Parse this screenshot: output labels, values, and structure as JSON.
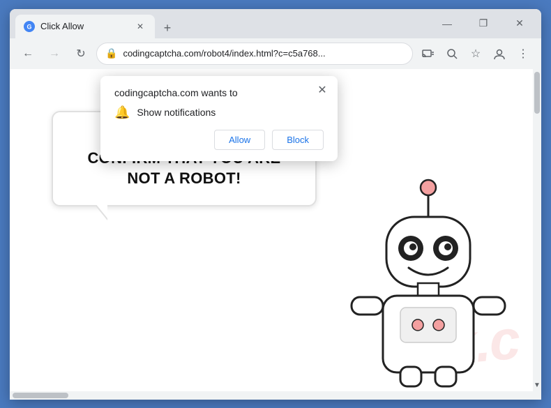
{
  "browser": {
    "tab_title": "Click Allow",
    "tab_favicon": "G",
    "address": "codingcaptcha.com/robot4/index.html?c=c5a768...",
    "window_controls": {
      "minimize": "—",
      "maximize": "❐",
      "close": "✕"
    },
    "nav": {
      "back": "←",
      "forward": "→",
      "reload": "↻",
      "new_tab": "+"
    }
  },
  "notification_popup": {
    "title": "codingcaptcha.com wants to",
    "notification_text": "Show notifications",
    "allow_label": "Allow",
    "block_label": "Block",
    "close_icon": "✕"
  },
  "page": {
    "speech_text": "CLICK «ALLOW» TO CONFIRM THAT YOU ARE NOT A ROBOT!",
    "watermark": "risk.c"
  },
  "icons": {
    "lock": "🔒",
    "bell": "🔔",
    "extensions": "⊞",
    "profile": "👤",
    "menu": "⋮",
    "download": "⬇",
    "bookmark": "☆",
    "search": "🔍"
  }
}
